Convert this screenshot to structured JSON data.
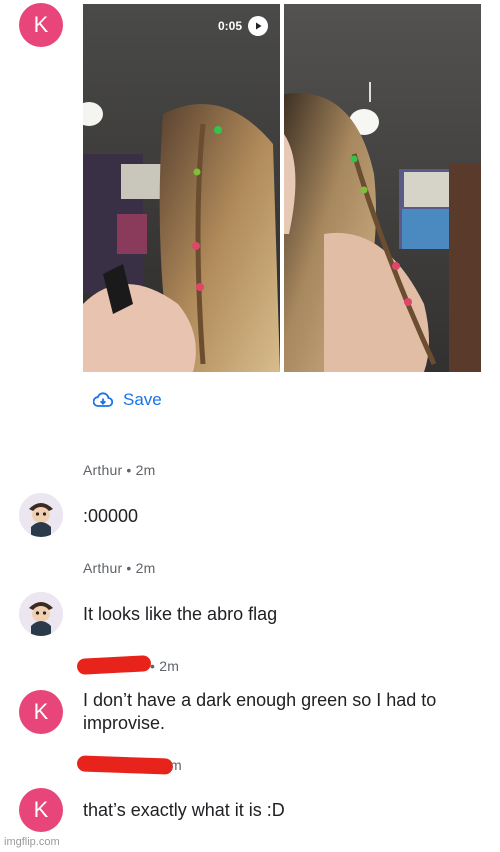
{
  "thread": {
    "top_avatar_letter": "K",
    "video_duration": "0:05",
    "save_label": "Save"
  },
  "messages": [
    {
      "author": "Arthur",
      "time": "2m",
      "text": ":00000"
    },
    {
      "author": "Arthur",
      "time": "2m",
      "text": "It looks like the abro flag"
    },
    {
      "author": "",
      "time": "2m",
      "text_line1": "I don’t have a dark enough green so I had to",
      "text_line2": "improvise.",
      "avatar_letter": "K"
    },
    {
      "author": "",
      "time": "m",
      "text": "that’s exactly what it is :D",
      "avatar_letter": "K"
    }
  ],
  "colors": {
    "avatar_k": "#e8457a",
    "accent_blue": "#1a73e8",
    "redaction": "#e8231c"
  },
  "icons": {
    "play": "play-icon",
    "save": "cloud-download-icon"
  },
  "watermark": "imgflip.com"
}
